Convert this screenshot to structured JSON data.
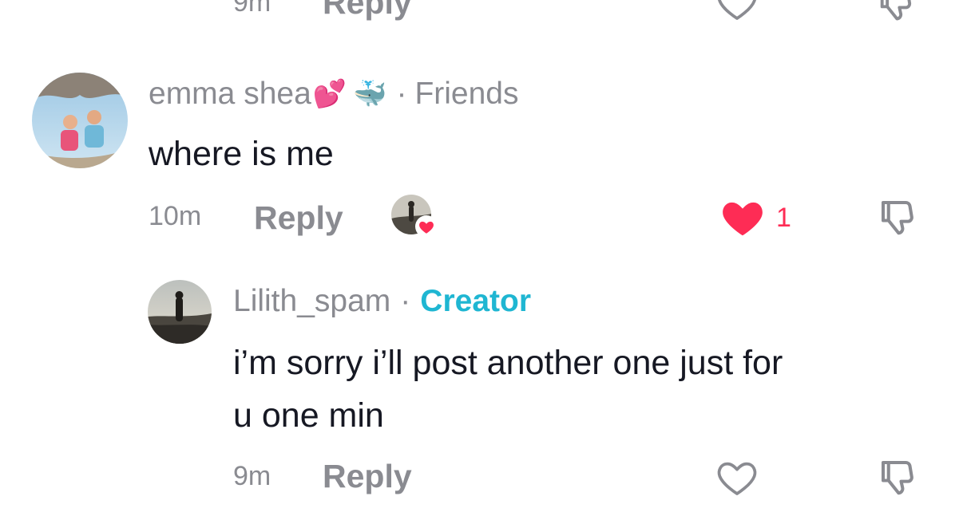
{
  "top_row": {
    "time": "9m",
    "reply_label": "Reply"
  },
  "comment": {
    "author": "emma shea",
    "author_emoji": "💕",
    "author_emoji2": "🐳",
    "separator": "·",
    "tag": "Friends",
    "text": "where is me",
    "time": "10m",
    "reply_label": "Reply",
    "like_count": "1",
    "liked": true,
    "accent_color": "#fe2c55"
  },
  "reply": {
    "author": "Lilith_spam",
    "separator": "·",
    "tag": "Creator",
    "tag_color": "#1fb6d2",
    "text_line1": "i’m sorry i’ll post another one just for",
    "text_line2": "u one min",
    "time": "9m",
    "reply_label": "Reply"
  },
  "icons": {
    "like": "heart-icon",
    "dislike": "thumbs-down-icon",
    "creator_liked": "creator-like-badge-icon"
  }
}
